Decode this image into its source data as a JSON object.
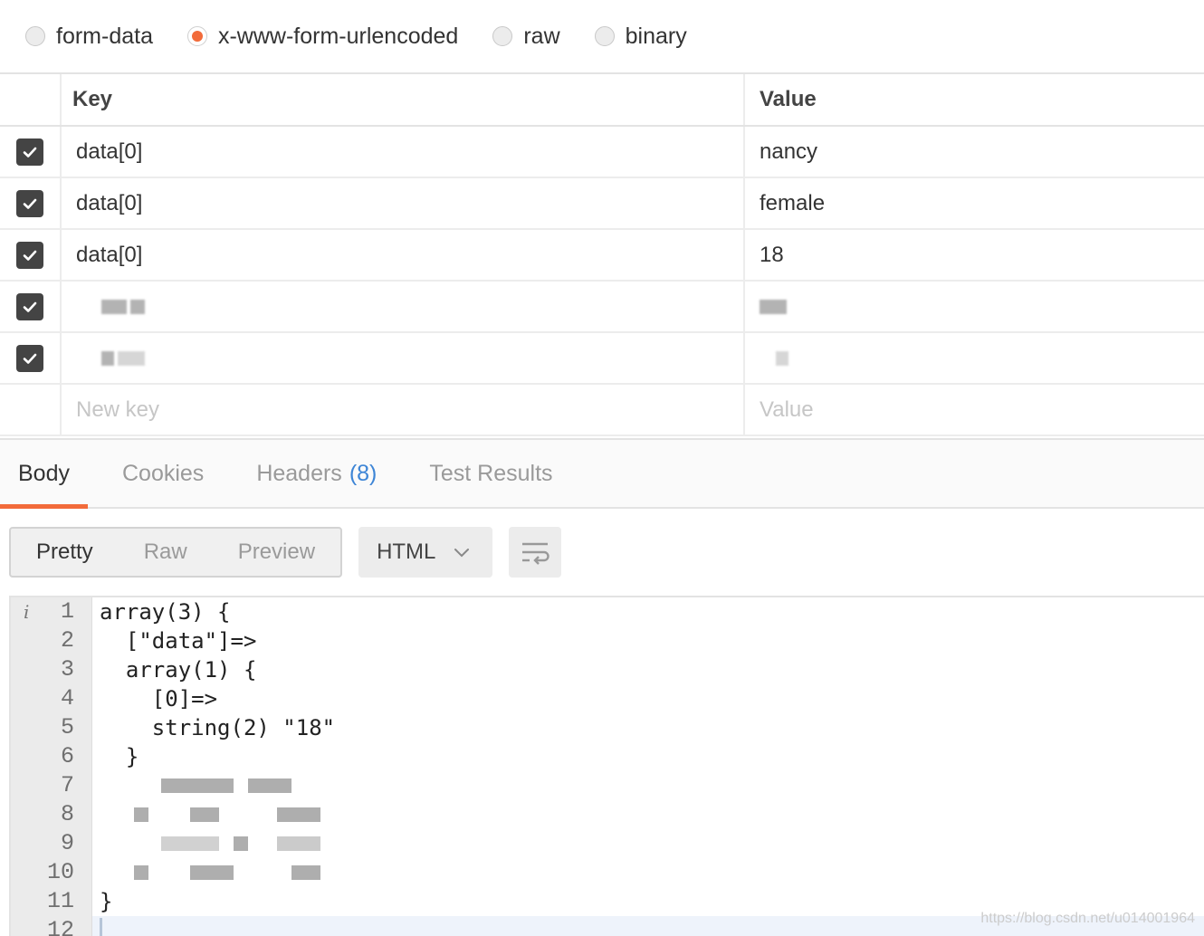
{
  "body_types": [
    {
      "label": "form-data",
      "checked": false
    },
    {
      "label": "x-www-form-urlencoded",
      "checked": true
    },
    {
      "label": "raw",
      "checked": false
    },
    {
      "label": "binary",
      "checked": false
    }
  ],
  "kv_table": {
    "key_header": "Key",
    "value_header": "Value",
    "rows": [
      {
        "key": "data[0]",
        "value": "nancy"
      },
      {
        "key": "data[0]",
        "value": "female"
      },
      {
        "key": "data[0]",
        "value": "18"
      }
    ],
    "new_key_placeholder": "New key",
    "new_value_placeholder": "Value"
  },
  "response_tabs": {
    "body": "Body",
    "cookies": "Cookies",
    "headers": "Headers",
    "headers_count": "(8)",
    "test_results": "Test Results"
  },
  "toolbar": {
    "pretty": "Pretty",
    "raw": "Raw",
    "preview": "Preview",
    "format": "HTML"
  },
  "code": {
    "lines": [
      {
        "num": "1",
        "text": "array(3) {"
      },
      {
        "num": "2",
        "text": "  [\"data\"]=>"
      },
      {
        "num": "3",
        "text": "  array(1) {"
      },
      {
        "num": "4",
        "text": "    [0]=>"
      },
      {
        "num": "5",
        "text": "    string(2) \"18\""
      },
      {
        "num": "6",
        "text": "  }"
      },
      {
        "num": "7",
        "text": ""
      },
      {
        "num": "8",
        "text": ""
      },
      {
        "num": "9",
        "text": ""
      },
      {
        "num": "10",
        "text": ""
      },
      {
        "num": "11",
        "text": "}"
      },
      {
        "num": "12",
        "text": ""
      }
    ]
  },
  "watermark": "https://blog.csdn.net/u014001964",
  "colors": {
    "accent": "#f26b3a",
    "badge": "#3d85d6"
  }
}
